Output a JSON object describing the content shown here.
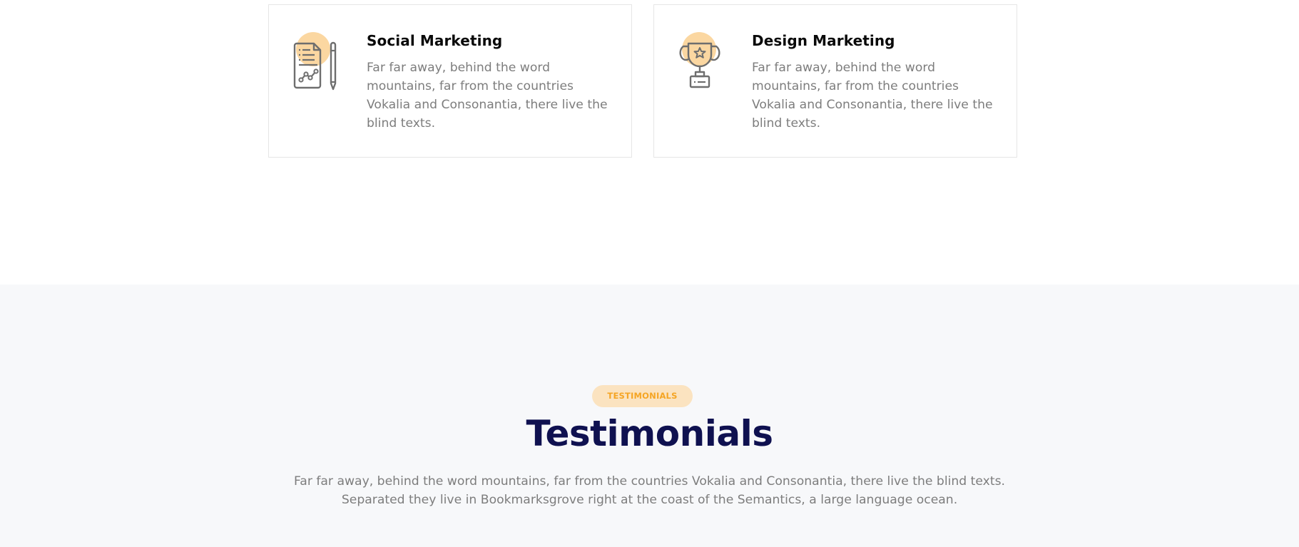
{
  "services": {
    "cards": [
      {
        "title": "Social Marketing",
        "text": "Far far away, behind the word mountains, far from the countries Vokalia and Consonantia, there live the blind texts.",
        "icon": "document-chart-pen-icon"
      },
      {
        "title": "Design Marketing",
        "text": "Far far away, behind the word mountains, far from the countries Vokalia and Consonantia, there live the blind texts.",
        "icon": "trophy-icon"
      }
    ]
  },
  "testimonials": {
    "badge": "TESTIMONIALS",
    "title": "Testimonials",
    "lead": "Far far away, behind the word mountains, far from the countries Vokalia and Consonantia, there live the blind texts. Separated they live in Bookmarksgrove right at the coast of the Semantics, a large language ocean."
  },
  "colors": {
    "accent": "#f5a524",
    "accent_soft": "#fbd7a1",
    "heading": "#0f1150",
    "body_text": "#7d7d7d",
    "section_bg": "#f7f8fa"
  }
}
